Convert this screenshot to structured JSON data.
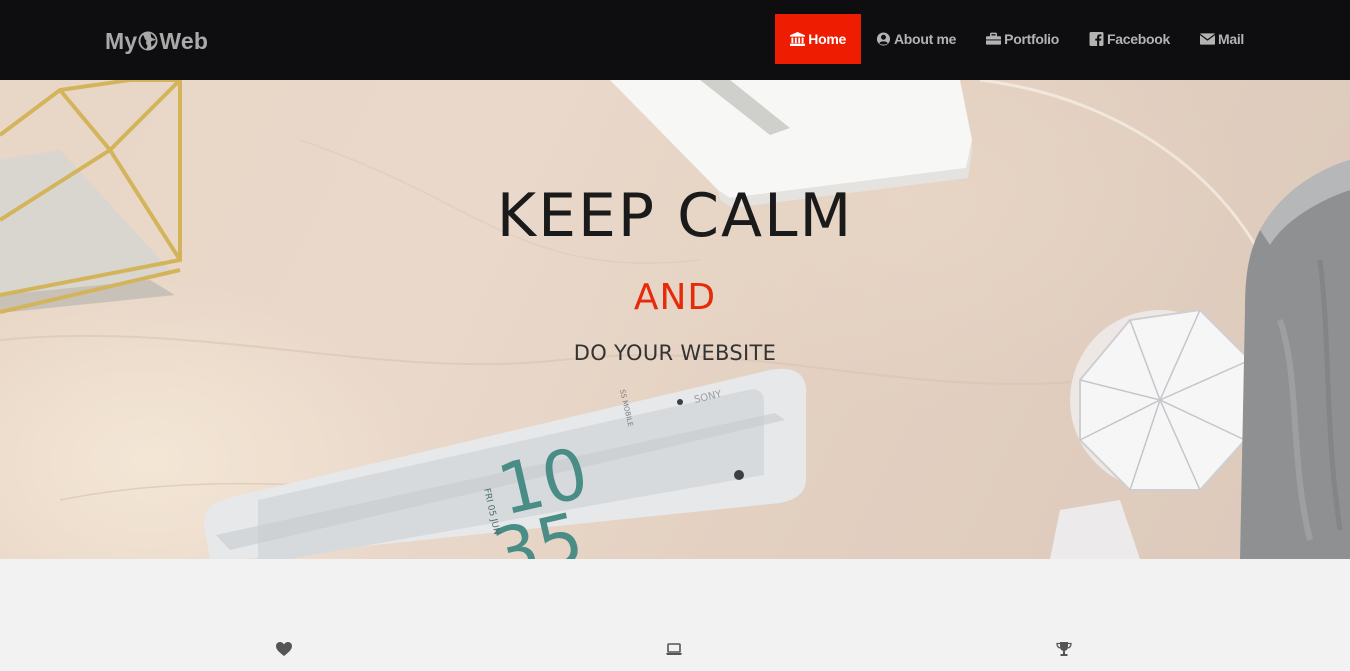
{
  "brand": {
    "prefix": "My",
    "suffix": "Web",
    "icon": "globe-icon"
  },
  "nav": {
    "items": [
      {
        "label": "Home",
        "icon": "bank-icon",
        "active": true
      },
      {
        "label": "About me",
        "icon": "user-circle-icon",
        "active": false
      },
      {
        "label": "Portfolio",
        "icon": "briefcase-icon",
        "active": false
      },
      {
        "label": "Facebook",
        "icon": "facebook-icon",
        "active": false
      },
      {
        "label": "Mail",
        "icon": "envelope-icon",
        "active": false
      }
    ]
  },
  "hero": {
    "title": "KEEP CALM",
    "and": "AND",
    "subtitle": "DO YOUR WEBSITE",
    "phone": {
      "brand": "SONY",
      "carrier": "SS MOBILE",
      "hour": "10",
      "minute": "35",
      "date": "FRI 05 JUN"
    }
  },
  "features": {
    "icons": [
      "heart-icon",
      "laptop-icon",
      "trophy-icon"
    ]
  },
  "colors": {
    "navbar_bg": "#0e0e10",
    "accent": "#ee1c00",
    "nav_text": "#b3b3b3",
    "page_bg": "#f2f2f2"
  }
}
